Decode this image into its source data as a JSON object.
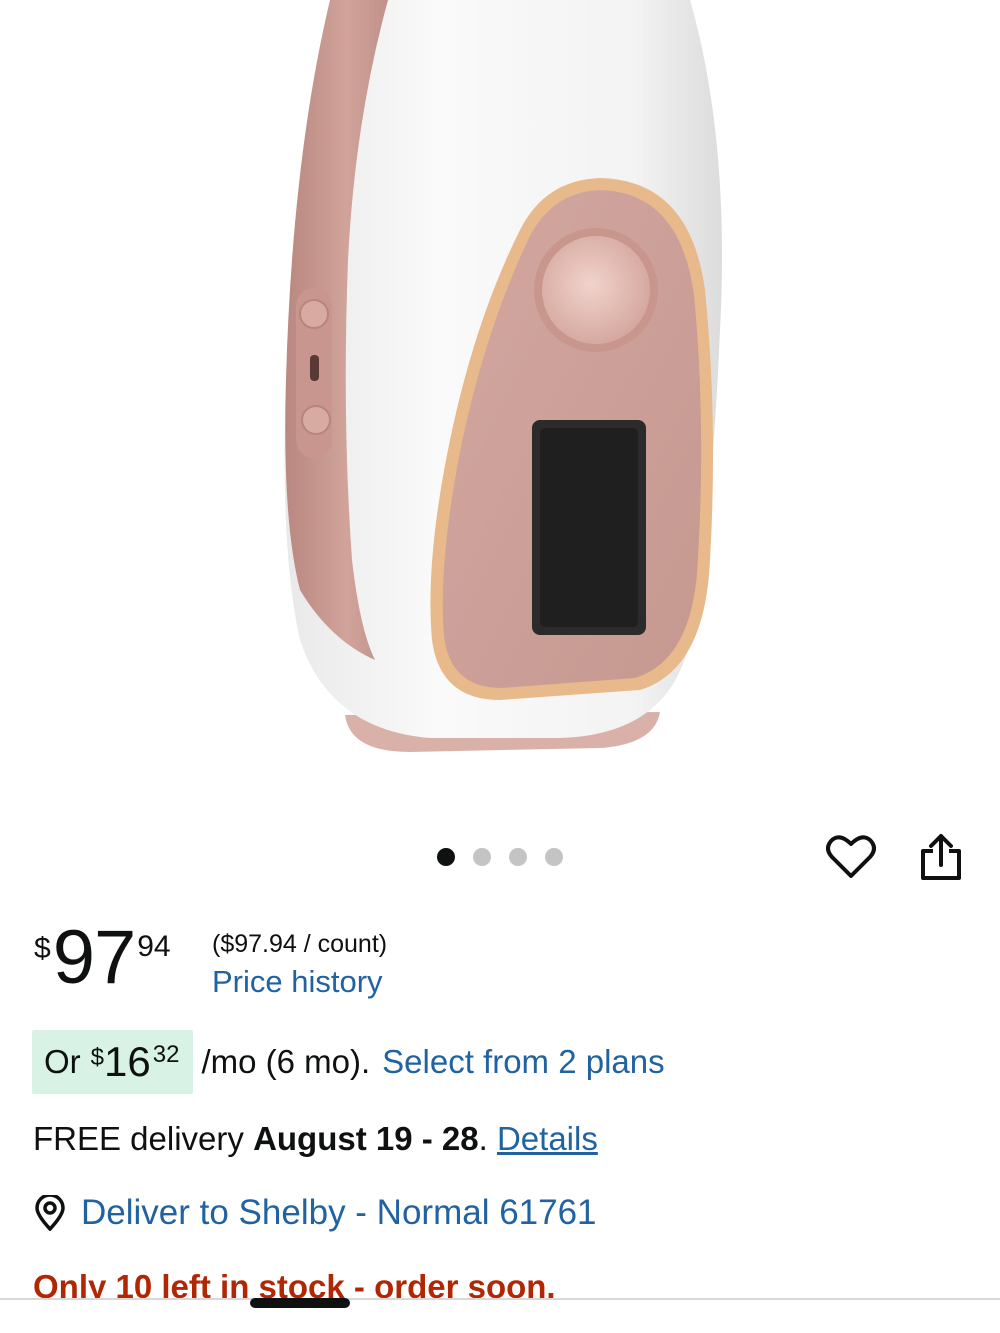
{
  "colors": {
    "accent_link": "#2162a1",
    "stock_warning": "#b12704",
    "installment_bg": "#d8f3e6",
    "product_rose": "#c99a92",
    "product_white": "#f4f4f4"
  },
  "carousel": {
    "count": 4,
    "active_index": 0
  },
  "actions": {
    "wishlist_icon": "heart-icon",
    "share_icon": "share-icon"
  },
  "price": {
    "symbol": "$",
    "whole": "97",
    "fraction": "94",
    "unit_price": "($97.94 / count)",
    "history_link": "Price history"
  },
  "installment": {
    "prefix": "Or",
    "symbol": "$",
    "whole": "16",
    "fraction": "32",
    "term": "/mo (6 mo).",
    "link": "Select from 2 plans"
  },
  "delivery": {
    "prefix": "FREE delivery",
    "dates": "August 19 - 28",
    "suffix": ".",
    "link": "Details"
  },
  "deliver_to": {
    "icon": "location-pin-icon",
    "text": "Deliver to Shelby - Normal 61761"
  },
  "stock": {
    "text": "Only 10 left in stock - order soon."
  }
}
